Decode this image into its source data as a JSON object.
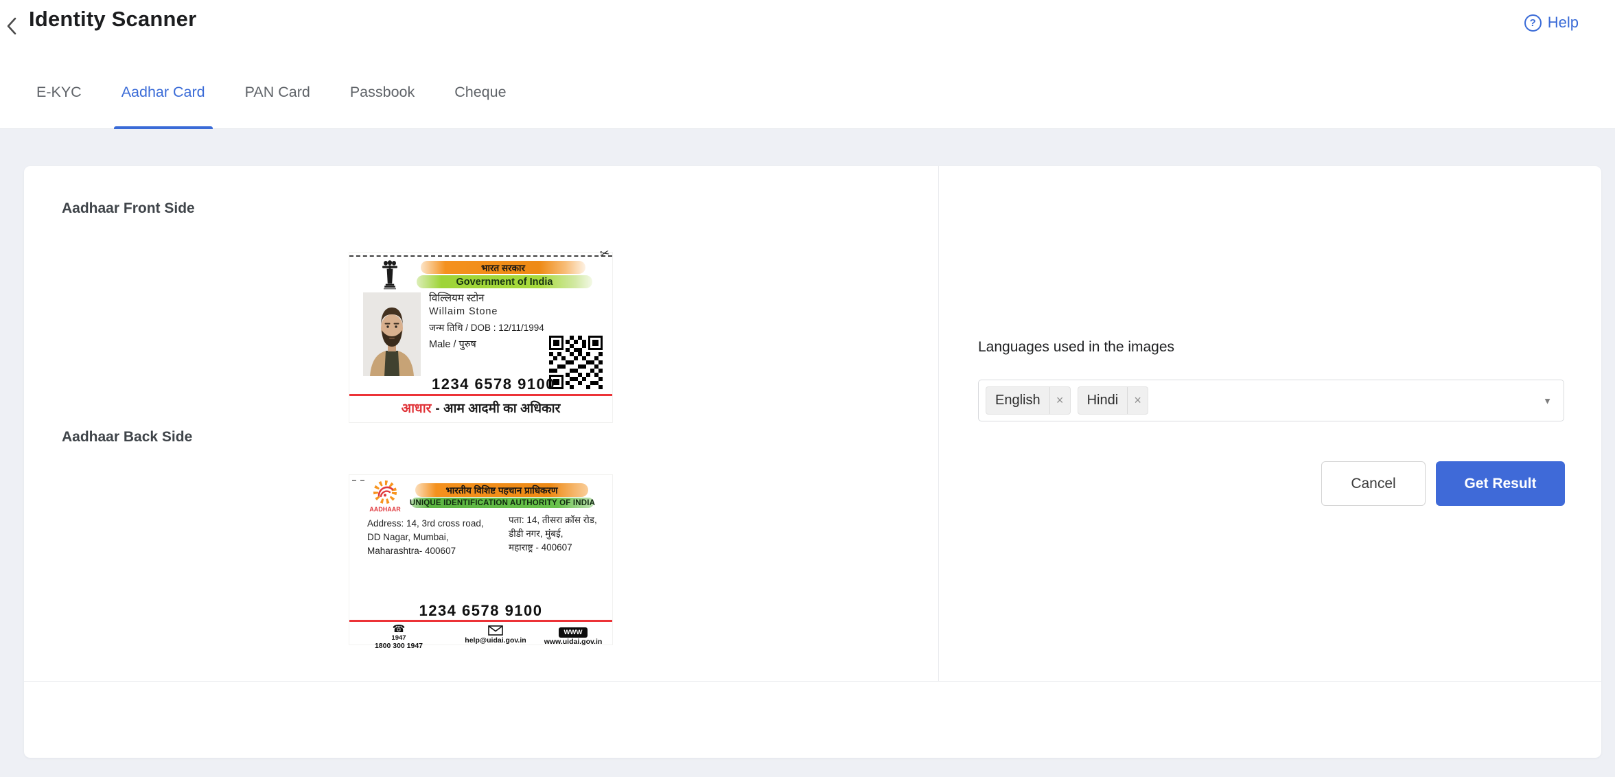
{
  "header": {
    "title": "Identity Scanner",
    "help_label": "Help",
    "help_icon_glyph": "?"
  },
  "tabs": [
    {
      "label": "E-KYC",
      "active": false
    },
    {
      "label": "Aadhar Card",
      "active": true
    },
    {
      "label": "PAN Card",
      "active": false
    },
    {
      "label": "Passbook",
      "active": false
    },
    {
      "label": "Cheque",
      "active": false
    }
  ],
  "left": {
    "front_heading": "Aadhaar Front Side",
    "back_heading": "Aadhaar Back Side",
    "front_card": {
      "govt_hindi": "भारत सरकार",
      "govt_english": "Government of India",
      "name_hindi": "विल्लियम स्टोन",
      "name_english": "Willaim Stone",
      "dob_line": "जन्म तिथि / DOB : 12/11/1994",
      "gender_line": "Male / पुरुष",
      "number": "1234 6578 9100",
      "slogan_prefix": "आधार",
      "slogan_rest": "- आम आदमी का अधिकार"
    },
    "back_card": {
      "logo_text": "AADHAAR",
      "authority_hindi": "भारतीय विशिष्ट पहचान प्राधिकरण",
      "authority_english": "UNIQUE IDENTIFICATION AUTHORITY OF INDIA",
      "address_english": [
        "Address: 14, 3rd cross road,",
        "DD Nagar, Mumbai,",
        "Maharashtra- 400607"
      ],
      "address_hindi": [
        "पता: 14, तीसरा क्रॉस रोड,",
        "डीडी नगर, मुंबई,",
        "महाराष्ट्र - 400607"
      ],
      "number": "1234 6578 9100",
      "phone_short": "1947",
      "phone_long": "1800 300 1947",
      "email": "help@uidai.gov.in",
      "www_badge": "WWW",
      "website": "www.uidai.gov.in"
    }
  },
  "right": {
    "languages_label": "Languages used in the images",
    "selected_languages": [
      "English",
      "Hindi"
    ],
    "cancel_label": "Cancel",
    "submit_label": "Get Result"
  },
  "icons": {
    "scissors": "✂",
    "phone": "☎",
    "caret": "▼",
    "remove": "×"
  },
  "colors": {
    "accent_blue": "#3a6bd7",
    "primary_button": "#3f6ad8",
    "card_red_line": "#ec3237",
    "banner_orange": "#f4911e",
    "banner_green": "#9ed437",
    "page_background": "#eef0f5"
  }
}
